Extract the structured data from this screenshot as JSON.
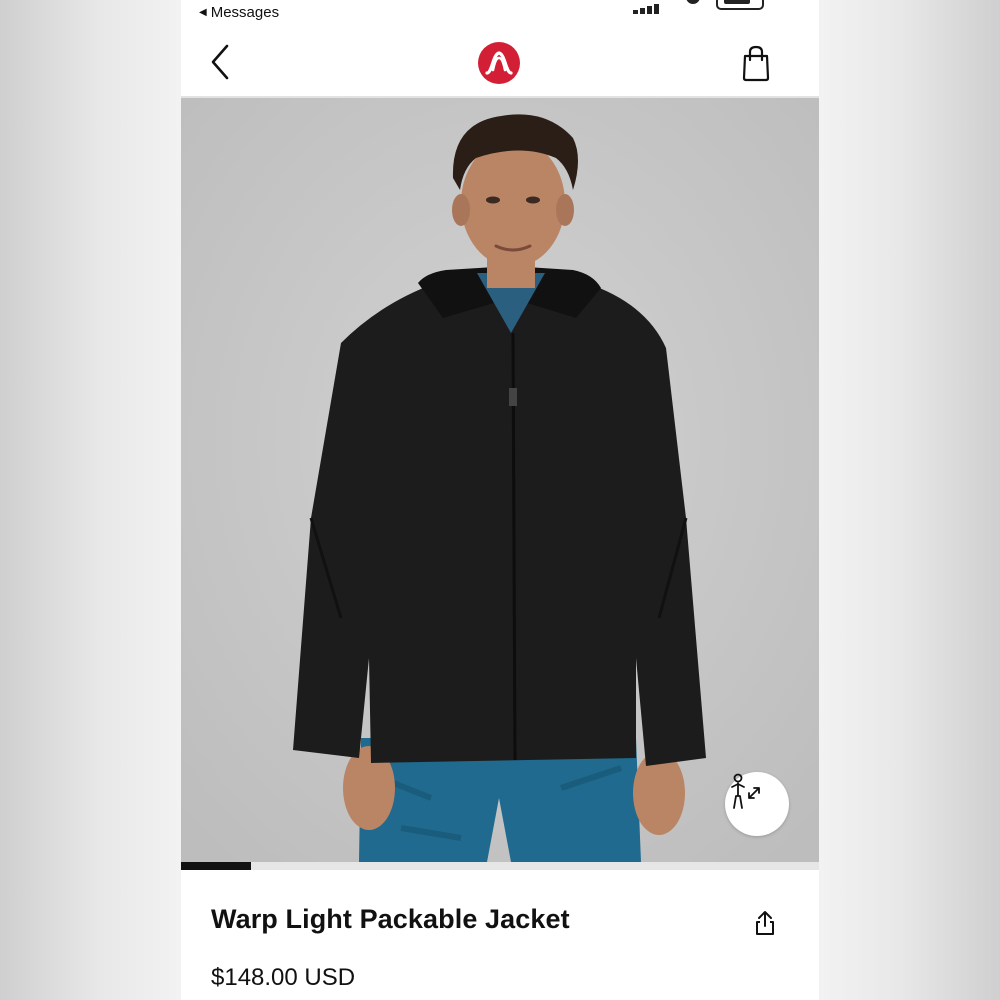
{
  "status_bar": {
    "back_label": "Messages"
  },
  "nav": {
    "back_icon": "chevron-left-icon",
    "logo_icon": "lululemon-logo",
    "bag_icon": "shopping-bag-icon"
  },
  "product": {
    "title": "Warp Light Packable Jacket",
    "price": "$148.00 USD",
    "gallery_progress": 0.11,
    "fit_icon": "size-fit-icon",
    "share_icon": "share-icon"
  },
  "colors": {
    "brand_red": "#d31f36",
    "jacket": "#1c1c1c",
    "shorts": "#1f6a8e",
    "photo_bg": "#c8c8c8"
  }
}
